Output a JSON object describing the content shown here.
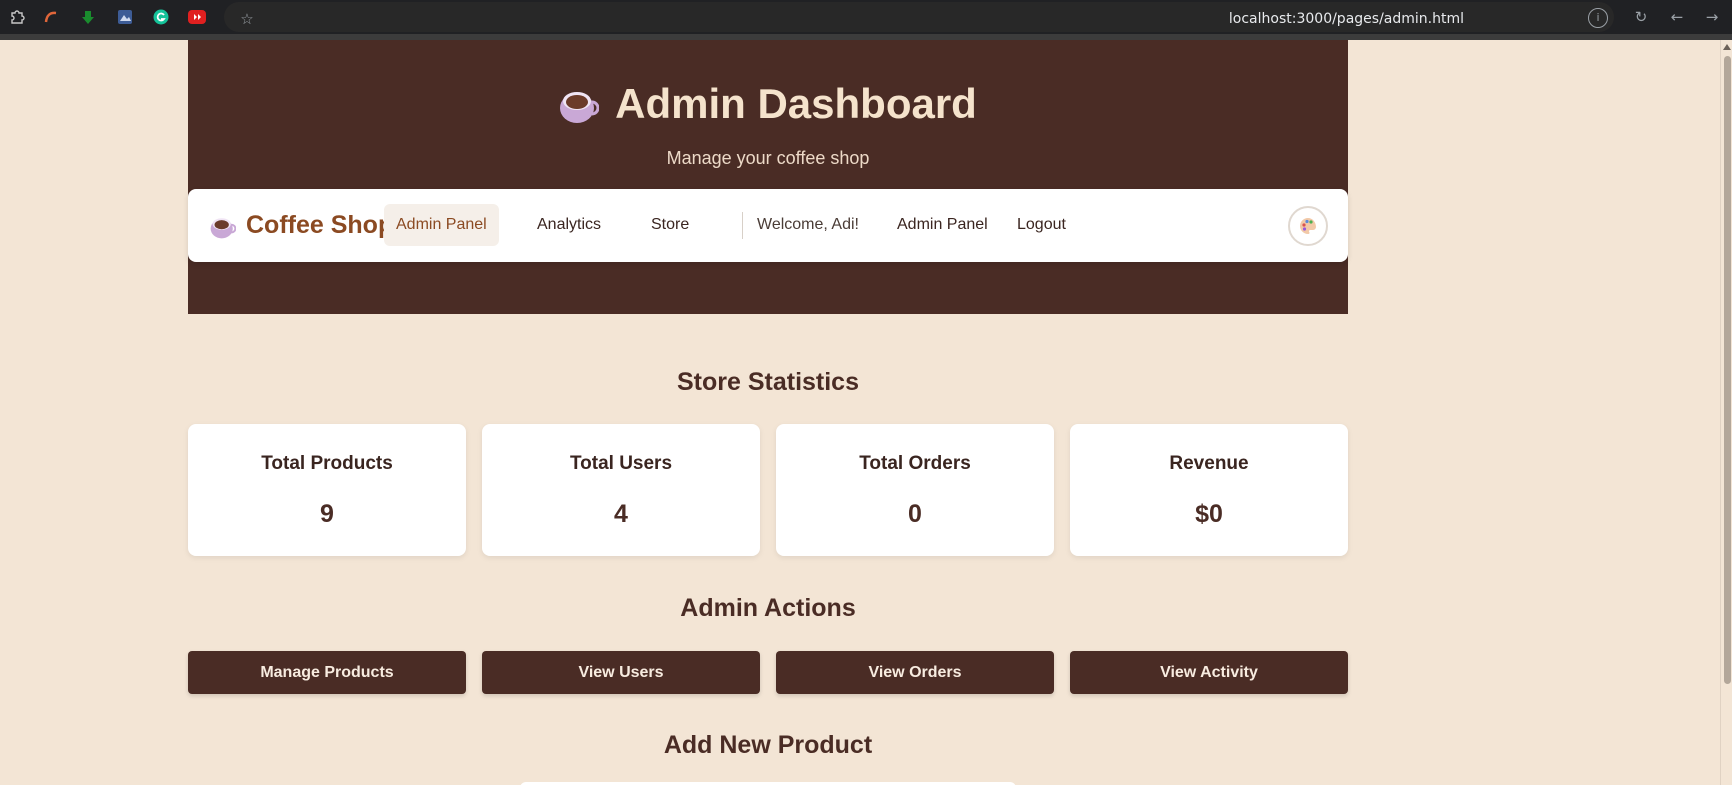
{
  "browser": {
    "url": "localhost:3000/pages/admin.html",
    "extension_icons": [
      "puzzle-icon",
      "arc-icon",
      "download-arrow-icon",
      "image-extension-icon",
      "grammarly-icon",
      "youtube-extension-icon"
    ]
  },
  "header": {
    "title": "Admin Dashboard",
    "subtitle": "Manage your coffee shop"
  },
  "navbar": {
    "brand": "Coffee Shop",
    "items": [
      {
        "label": "Admin Panel",
        "active": true
      },
      {
        "label": "Analytics",
        "active": false
      },
      {
        "label": "Store",
        "active": false
      }
    ],
    "welcome": "Welcome, Adi!",
    "user_links": [
      "Admin Panel",
      "Logout"
    ],
    "theme_icon": "palette-icon"
  },
  "stats": {
    "title": "Store Statistics",
    "cards": [
      {
        "label": "Total Products",
        "value": "9"
      },
      {
        "label": "Total Users",
        "value": "4"
      },
      {
        "label": "Total Orders",
        "value": "0"
      },
      {
        "label": "Revenue",
        "value": "$0"
      }
    ]
  },
  "actions": {
    "title": "Admin Actions",
    "buttons": [
      "Manage Products",
      "View Users",
      "View Orders",
      "View Activity"
    ]
  },
  "add_product": {
    "title": "Add New Product"
  },
  "colors": {
    "primary": "#4a2c25",
    "background": "#f3e5d5",
    "brand": "#8b4a22",
    "card": "#ffffff"
  }
}
